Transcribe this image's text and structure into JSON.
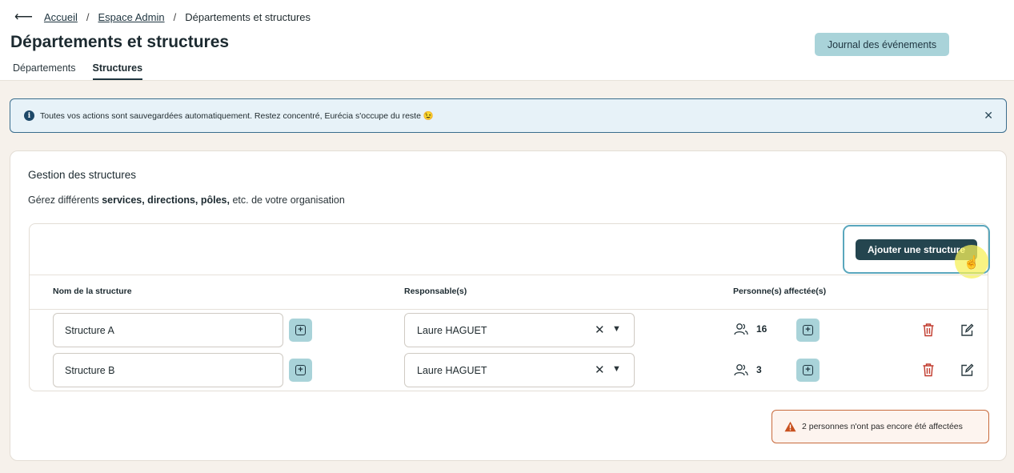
{
  "breadcrumb": {
    "home": "Accueil",
    "admin": "Espace Admin",
    "current": "Départements et structures"
  },
  "page_title": "Départements et structures",
  "journal_button": "Journal des événements",
  "tabs": [
    {
      "label": "Départements",
      "active": false
    },
    {
      "label": "Structures",
      "active": true
    }
  ],
  "alert": {
    "text": "Toutes vos actions sont sauvegardées automatiquement. Restez concentré, Eurécia s'occupe du reste 😉"
  },
  "card": {
    "title": "Gestion des structures",
    "desc_prefix": "Gérez différents ",
    "desc_bold": "services, directions, pôles,",
    "desc_suffix": " etc. de votre organisation"
  },
  "add_button": "Ajouter une structure",
  "columns": {
    "name": "Nom de la structure",
    "manager": "Responsable(s)",
    "assigned": "Personne(s) affectée(s)"
  },
  "rows": [
    {
      "name": "Structure A",
      "manager": "Laure HAGUET",
      "count": "16"
    },
    {
      "name": "Structure B",
      "manager": "Laure HAGUET",
      "count": "3"
    }
  ],
  "warning": "2 personnes n'ont pas encore été affectées",
  "colors": {
    "accent_dark": "#24454f",
    "accent_light": "#a9d3d9",
    "danger": "#c0392b",
    "warning": "#c86a3c"
  }
}
